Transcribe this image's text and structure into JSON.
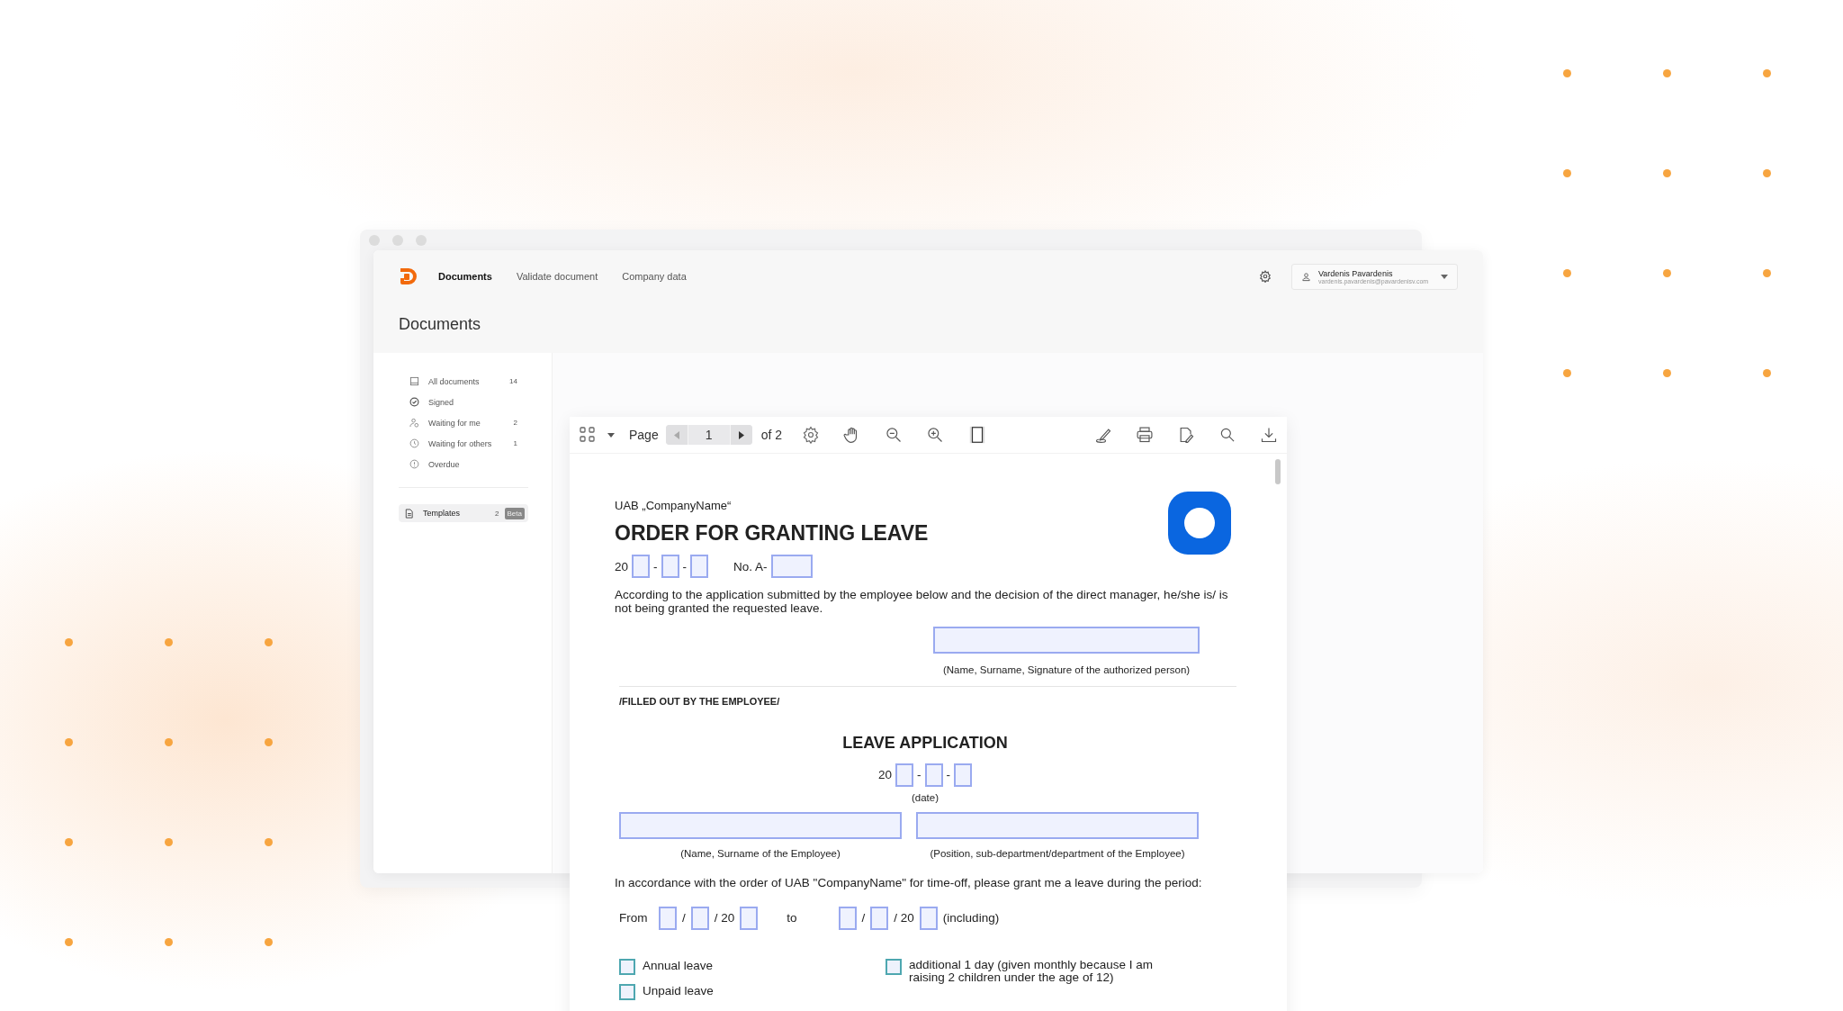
{
  "app": {
    "nav": [
      {
        "label": "Documents",
        "selected": true
      },
      {
        "label": "Validate document",
        "selected": false
      },
      {
        "label": "Company data",
        "selected": false
      }
    ],
    "user": {
      "name": "Vardenis Pavardenis",
      "email": "vardenis.pavardenis@pavardenisv.com"
    },
    "page_title": "Documents"
  },
  "sidebar": {
    "items": [
      {
        "label": "All documents",
        "count": "14",
        "kind": "inbox"
      },
      {
        "label": "Signed",
        "kind": "check"
      },
      {
        "label": "Waiting for me",
        "count": "2",
        "kind": "person"
      },
      {
        "label": "Waiting for others",
        "count": "1",
        "kind": "clock"
      },
      {
        "label": "Overdue",
        "kind": "alert"
      }
    ],
    "templates": {
      "label": "Templates",
      "count": "2",
      "badge": "Beta",
      "selected": true
    }
  },
  "viewer": {
    "toolbar": {
      "page_label": "Page",
      "page": "1",
      "page_count": "of 2"
    },
    "document": {
      "company": "UAB „CompanyName“",
      "title": "ORDER FOR GRANTING LEAVE",
      "date_prefix": "20",
      "date_separators": [
        "-",
        "-"
      ],
      "number_label": "No. A-",
      "decision_text": "According to the application submitted by the employee below and the decision of the direct manager, he/she is/ is not being granted the requested leave.",
      "signature_caption": "(Name, Surname, Signature of the authorized person)",
      "section_label": "/FILLED OUT BY THE EMPLOYEE/",
      "application_title": "LEAVE APPLICATION",
      "application_date_prefix": "20",
      "application_date_separators": [
        "-",
        "-"
      ],
      "date_caption": "(date)",
      "employee_caption": "(Name, Surname of the Employee)",
      "position_caption": "(Position, sub-department/department of the Employee)",
      "request_text": "In accordance with the order of UAB \"CompanyName\" for time-off, please grant me a leave during the period:",
      "period": {
        "from": "From",
        "from_sep": "/",
        "from_year": "/ 20",
        "to": "to",
        "to_sep": "/",
        "to_year": "/ 20",
        "including": "(including)"
      },
      "leave_types": [
        {
          "label": "Annual leave",
          "checked": false
        },
        {
          "label": "additional 1 day (given monthly because I am raising 2 children under the age of 12)",
          "checked": false
        },
        {
          "label": "Unpaid leave",
          "checked": false
        }
      ]
    }
  }
}
